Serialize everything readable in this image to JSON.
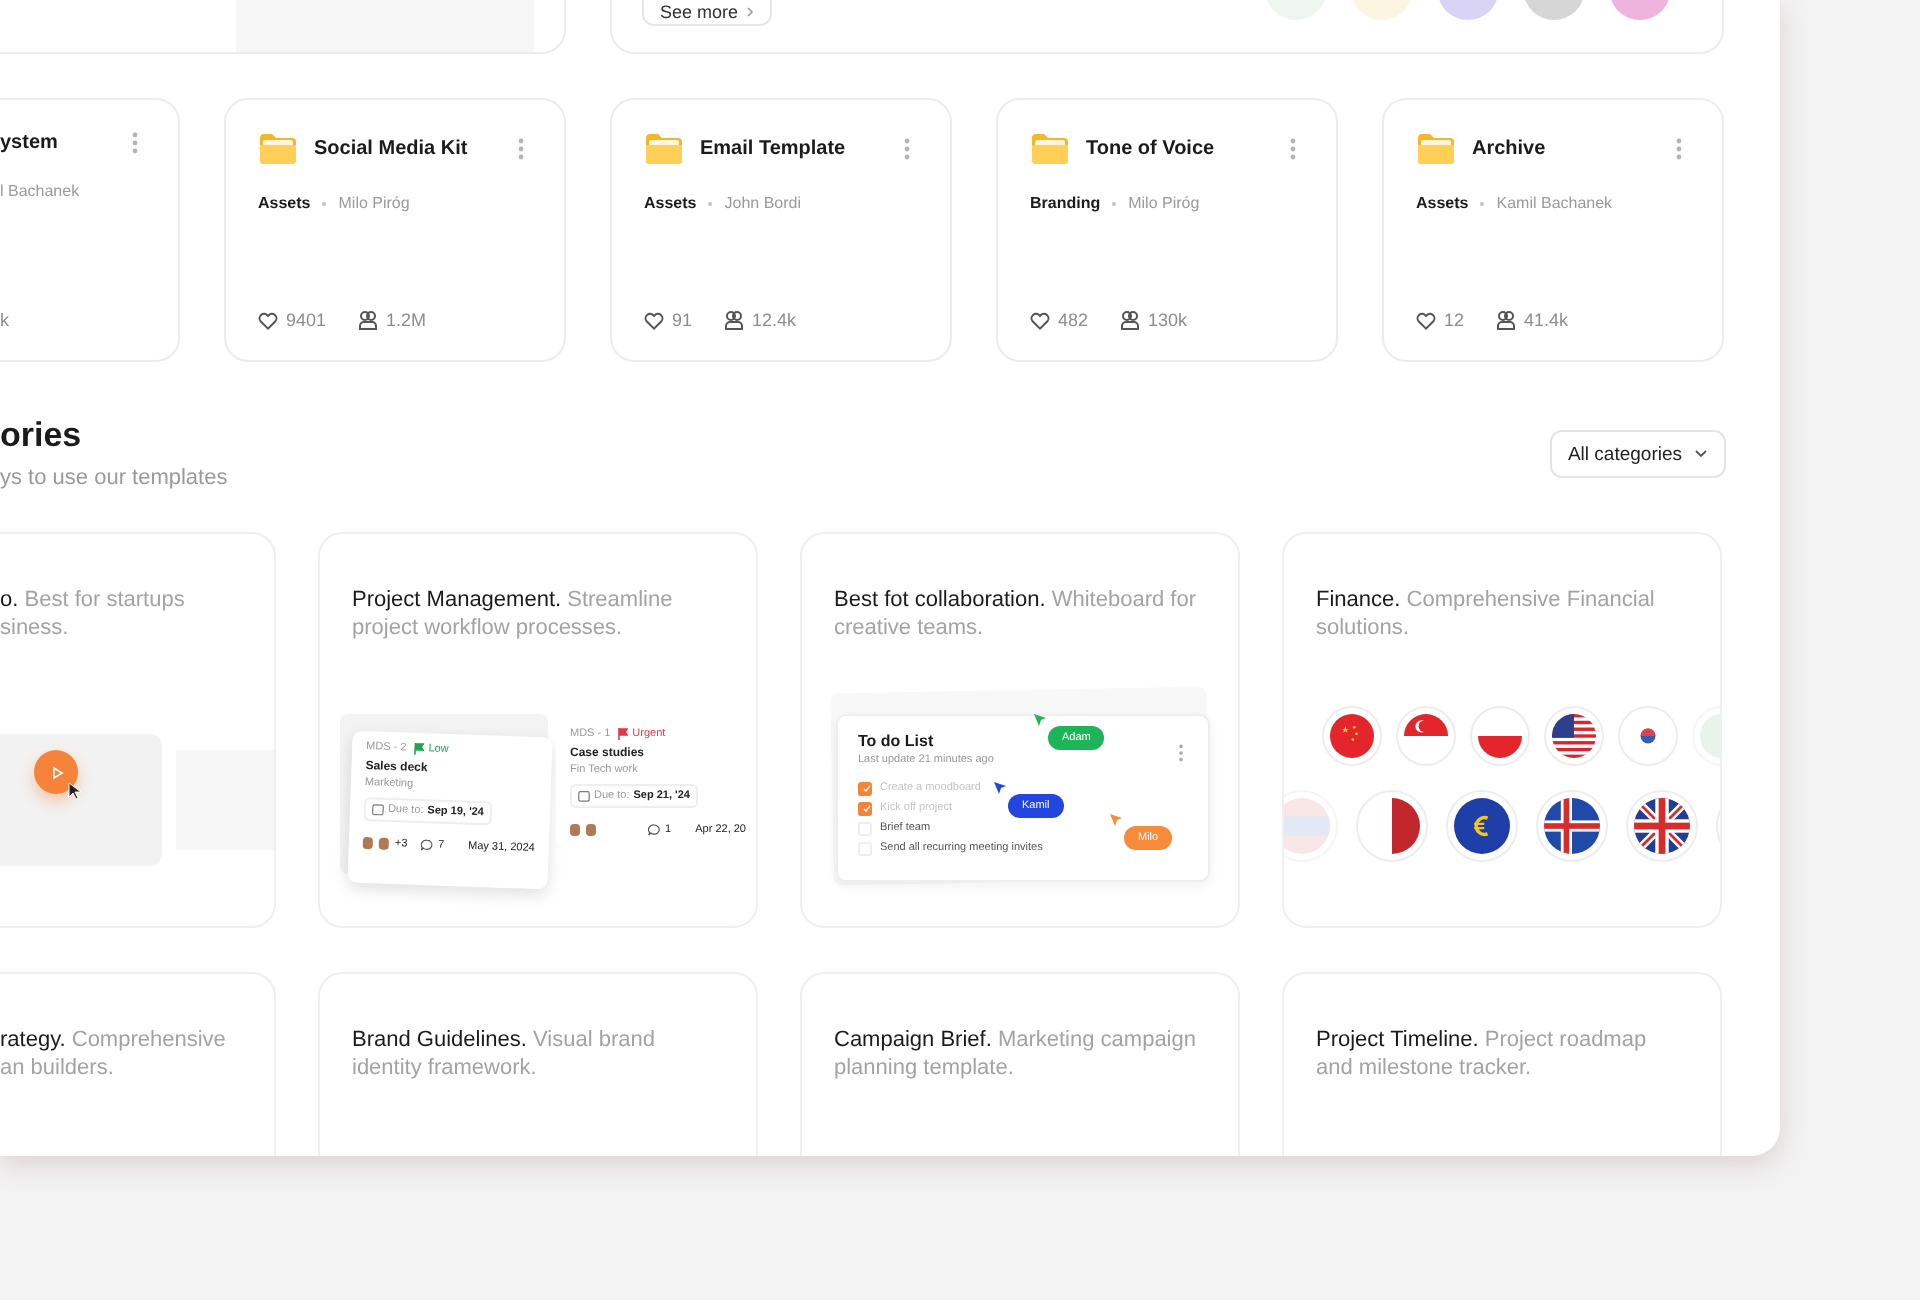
{
  "top_row": {
    "see_more": "See more"
  },
  "files": [
    {
      "kind": "partial",
      "title": "ystem",
      "author": "l Bachanek",
      "users": "k"
    },
    {
      "kind": "full",
      "title": "Social Media Kit",
      "category": "Assets",
      "author": "Milo Piróg",
      "likes": "9401",
      "users": "1.2M"
    },
    {
      "kind": "full",
      "title": "Email Template",
      "category": "Assets",
      "author": "John Bordi",
      "likes": "91",
      "users": "12.4k"
    },
    {
      "kind": "full",
      "title": "Tone of Voice",
      "category": "Branding",
      "author": "Milo Piróg",
      "likes": "482",
      "users": "130k"
    },
    {
      "kind": "full",
      "title": "Archive",
      "category": "Assets",
      "author": "Kamil Bachanek",
      "likes": "12",
      "users": "41.4k"
    }
  ],
  "categories_header": {
    "title": "ories",
    "subtitle": "ys to use our templates",
    "filter": "All categories"
  },
  "categories": [
    {
      "kind": "video",
      "partial": true,
      "title": "o.",
      "description": "Best for startups\nsiness."
    },
    {
      "kind": "tasks",
      "partial": false,
      "title": "Project Management.",
      "description": "Streamline project workflow processes.",
      "tasks": [
        {
          "id": "MDS - 2",
          "priority": "Low",
          "color": "#1ea34f",
          "title": "Sales deck",
          "project": "Marketing",
          "due_label": "Due to:",
          "due": "Sep 19, '24",
          "extra": "+3",
          "comments": "7",
          "date": "May 31, 2024"
        },
        {
          "id": "MDS - 1",
          "priority": "Urgent",
          "color": "#e5364b",
          "title": "Case studies",
          "project": "Fin Tech work",
          "due_label": "Due to:",
          "due": "Sep 21, '24",
          "comments": "1",
          "date": "Apr 22, 20"
        }
      ]
    },
    {
      "kind": "todo",
      "partial": false,
      "title": "Best fot collaboration.",
      "description": "Whiteboard for creative teams.",
      "todo": {
        "title": "To do List",
        "subtitle": "Last update 21 minutes ago",
        "items": [
          {
            "text": "Create a moodboard",
            "checked": true
          },
          {
            "text": "Kick off project",
            "checked": true
          },
          {
            "text": "Brief team",
            "checked": false
          },
          {
            "text": "Send all recurring meeting invites",
            "checked": false
          }
        ],
        "cursors": [
          {
            "name": "Adam",
            "color": "#1fb35a"
          },
          {
            "name": "Kamil",
            "color": "#2446e0"
          },
          {
            "name": "Milo",
            "color": "#f58b3b"
          }
        ]
      }
    },
    {
      "kind": "flags",
      "partial": false,
      "title": "Finance.",
      "description": "Comprehensive Financial solutions."
    },
    {
      "kind": "plain",
      "partial": true,
      "title": "rategy.",
      "description": "Comprehensive\nan builders."
    },
    {
      "kind": "plain",
      "partial": false,
      "title": "Brand Guidelines.",
      "description": "Visual brand identity framework."
    },
    {
      "kind": "plain",
      "partial": false,
      "title": "Campaign Brief.",
      "description": "Marketing campaign planning template."
    },
    {
      "kind": "plain",
      "partial": false,
      "title": "Project Timeline.",
      "description": "Project roadmap and milestone tracker."
    }
  ]
}
